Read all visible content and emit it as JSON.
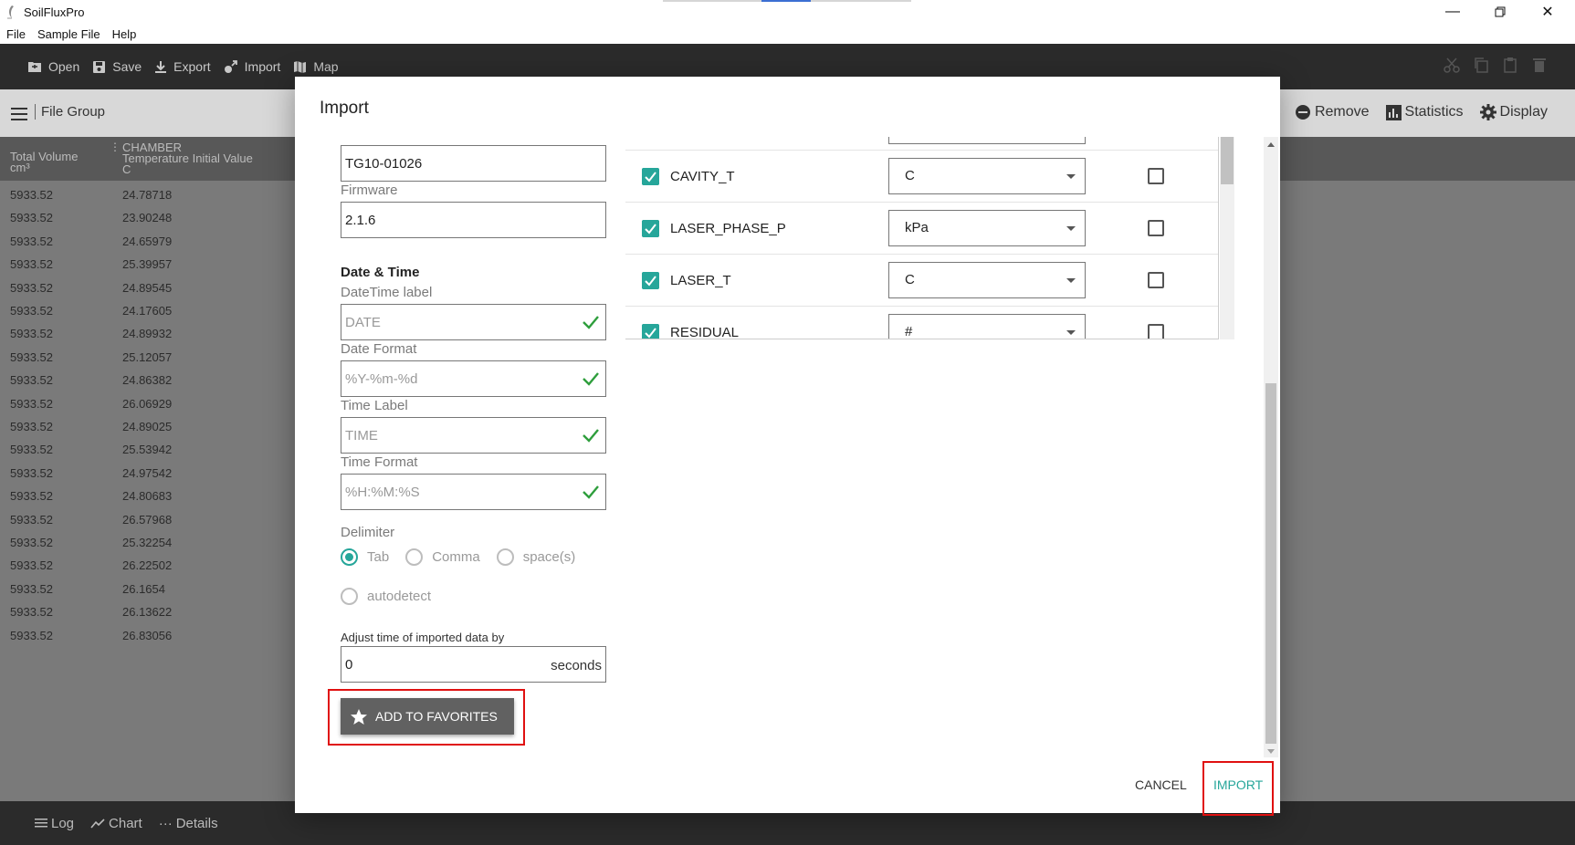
{
  "window": {
    "title": "SoilFluxPro"
  },
  "menu": [
    "File",
    "Sample File",
    "Help"
  ],
  "toolbar": {
    "open": "Open",
    "save": "Save",
    "export": "Export",
    "import": "Import",
    "map": "Map"
  },
  "subbar": {
    "file_group": "File Group",
    "remove": "Remove",
    "statistics": "Statistics",
    "display": "Display"
  },
  "table": {
    "col1": {
      "line1": "Total Volume",
      "line2": "cm³"
    },
    "col2": {
      "line1": "CHAMBER",
      "line2": "Temperature Initial Value",
      "line3": "C"
    },
    "rows": [
      [
        "5933.52",
        "24.78718"
      ],
      [
        "5933.52",
        "23.90248"
      ],
      [
        "5933.52",
        "24.65979"
      ],
      [
        "5933.52",
        "25.39957"
      ],
      [
        "5933.52",
        "24.89545"
      ],
      [
        "5933.52",
        "24.17605"
      ],
      [
        "5933.52",
        "24.89932"
      ],
      [
        "5933.52",
        "25.12057"
      ],
      [
        "5933.52",
        "24.86382"
      ],
      [
        "5933.52",
        "26.06929"
      ],
      [
        "5933.52",
        "24.89025"
      ],
      [
        "5933.52",
        "25.53942"
      ],
      [
        "5933.52",
        "24.97542"
      ],
      [
        "5933.52",
        "24.80683"
      ],
      [
        "5933.52",
        "26.57968"
      ],
      [
        "5933.52",
        "25.32254"
      ],
      [
        "5933.52",
        "26.22502"
      ],
      [
        "5933.52",
        "26.1654"
      ],
      [
        "5933.52",
        "26.13622"
      ],
      [
        "5933.52",
        "26.83056"
      ]
    ]
  },
  "bottombar": {
    "log": "Log",
    "chart": "Chart",
    "details": "Details"
  },
  "dialog": {
    "title": "Import",
    "serial_value": "TG10-01026",
    "firmware_label": "Firmware",
    "firmware_value": "2.1.6",
    "datetime_heading": "Date & Time",
    "datetime_label_label": "DateTime label",
    "datetime_label_value": "DATE",
    "date_format_label": "Date Format",
    "date_format_value": "%Y-%m-%d",
    "time_label_label": "Time Label",
    "time_label_value": "TIME",
    "time_format_label": "Time Format",
    "time_format_value": "%H:%M:%S",
    "delimiter_label": "Delimiter",
    "delimiter_options": [
      "Tab",
      "Comma",
      "space(s)",
      "autodetect"
    ],
    "delimiter_selected": "Tab",
    "adjust_label": "Adjust time of imported data by",
    "adjust_value": "0",
    "adjust_suffix": "seconds",
    "add_favorites": "ADD TO FAVORITES",
    "variables": [
      {
        "name": "CAVITY_T",
        "unit": "C",
        "checked": true
      },
      {
        "name": "LASER_PHASE_P",
        "unit": "kPa",
        "checked": true
      },
      {
        "name": "LASER_T",
        "unit": "C",
        "checked": true
      },
      {
        "name": "RESIDUAL",
        "unit": "#",
        "checked": true
      }
    ],
    "cancel": "CANCEL",
    "import": "IMPORT"
  },
  "colors": {
    "accent": "#26a69a",
    "highlight": "#e01010",
    "toolbar_bg": "#2b2b2b"
  }
}
